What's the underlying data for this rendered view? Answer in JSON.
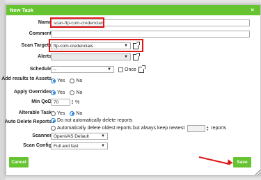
{
  "dialog": {
    "title": "New Task",
    "close_glyph": "×"
  },
  "fields": {
    "name": {
      "label": "Name",
      "value": "scan-ftp-com-credenciais"
    },
    "comment": {
      "label": "Comment",
      "value": ""
    },
    "scan_targets": {
      "label": "Scan Targets",
      "selected": "ftp-com-credenciais"
    },
    "alerts": {
      "label": "Alerts",
      "selected": ""
    },
    "schedule": {
      "label": "Schedule",
      "selected": "--",
      "once_label": "Once",
      "once_checked": false
    },
    "add_results": {
      "label": "Add results to Assets",
      "yes": "Yes",
      "no": "No",
      "selected": "yes"
    },
    "apply_overrides": {
      "label": "Apply Overrides",
      "yes": "Yes",
      "no": "No",
      "selected": "yes"
    },
    "min_qod": {
      "label": "Min QoD",
      "value": "70",
      "unit": "%"
    },
    "alterable": {
      "label": "Alterable Task",
      "yes": "Yes",
      "no": "No",
      "selected": "no"
    },
    "auto_delete": {
      "label": "Auto Delete Reports",
      "option1": "Do not automatically delete reports",
      "option2": "Automatically delete oldest reports but always keep newest",
      "keep_value": "",
      "reports_suffix": "reports",
      "selected": "option1"
    },
    "scanner": {
      "label": "Scanner",
      "selected": "OpenVAS Default"
    },
    "scan_config": {
      "label": "Scan Config",
      "selected": "Full and fast"
    }
  },
  "buttons": {
    "cancel": "Cancel",
    "save": "Save"
  },
  "colors": {
    "accent": "#66c430",
    "highlight": "#e01616",
    "radio": "#1a7bd6"
  },
  "icons": {
    "dropdown": "▼",
    "new": "new-icon"
  }
}
